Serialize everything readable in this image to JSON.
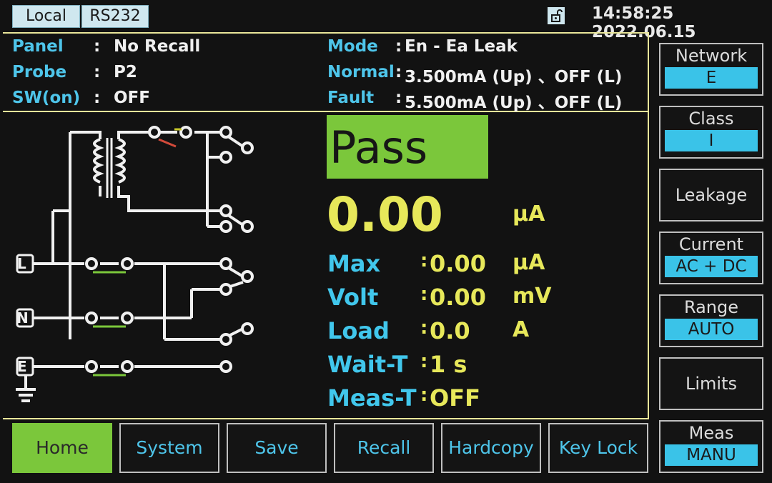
{
  "top_bar": {
    "mode_label": "Local",
    "interface_label": "RS232",
    "lock_icon": "unlock-icon",
    "datetime": "14:58:25 2022.06.15"
  },
  "info": {
    "panel_label": "Panel",
    "panel_value": "No Recall",
    "probe_label": "Probe",
    "probe_value": "P2",
    "sw_label": "SW(on)",
    "sw_value": "OFF",
    "mode_label": "Mode",
    "mode_value": "En - Ea Leak",
    "normal_label": "Normal",
    "normal_value": "3.500mA (Up) 、OFF (L)",
    "fault_label": "Fault",
    "fault_value": "5.500mA (Up) 、OFF (L)",
    "colon": ":"
  },
  "result": {
    "status": "Pass",
    "reading": "0.00",
    "reading_unit": "µA"
  },
  "measurements": {
    "max_label": "Max",
    "max_value": "0.00",
    "max_unit": "µA",
    "volt_label": "Volt",
    "volt_value": "0.00",
    "volt_unit": "mV",
    "load_label": "Load",
    "load_value": "0.0",
    "load_unit": "A",
    "wait_label": "Wait-T",
    "wait_value": "1 s",
    "meas_label": "Meas-T",
    "meas_value": "OFF"
  },
  "circuit": {
    "l_label": "L",
    "n_label": "N",
    "e_label": "E"
  },
  "side_menu": {
    "network_label": "Network",
    "network_value": "E",
    "class_label": "Class",
    "class_value": "I",
    "leakage_label": "Leakage",
    "current_label": "Current",
    "current_value": "AC + DC",
    "range_label": "Range",
    "range_value": "AUTO",
    "limits_label": "Limits",
    "meas_label": "Meas",
    "meas_value": "MANU"
  },
  "bottom_menu": {
    "home": "Home",
    "system": "System",
    "save": "Save",
    "recall": "Recall",
    "hardcopy": "Hardcopy",
    "keylock": "Key Lock"
  },
  "colors": {
    "accent_cyan": "#41c7ec",
    "accent_yellow": "#e7e85a",
    "pass_green": "#7bc73b"
  }
}
